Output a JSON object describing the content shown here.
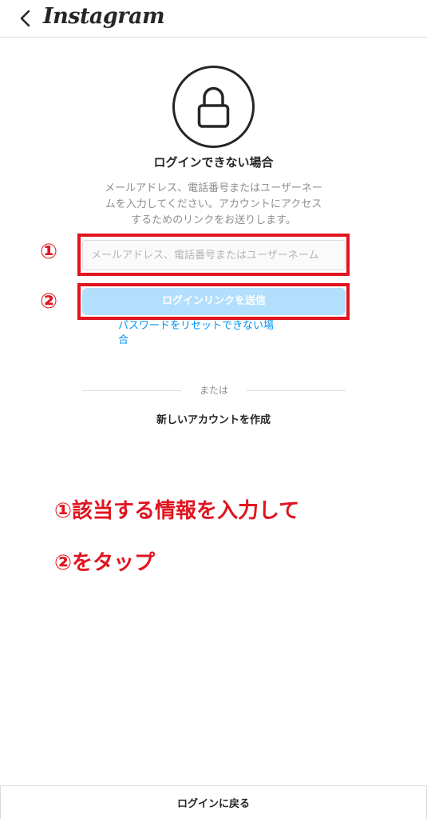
{
  "header": {
    "back_icon": "chevron-left-icon",
    "brand": "Instagram"
  },
  "lock_icon": "lock-icon",
  "title": "ログインできない場合",
  "description_lines": [
    "メールアドレス、電話番号またはユーザーネー",
    "ムを入力してください。アカウントにアクセス",
    "するためのリンクをお送りします。"
  ],
  "form": {
    "email_placeholder": "メールアドレス、電話番号またはユーザーネーム",
    "send_label": "ログインリンクを送信"
  },
  "reset_link_lines": [
    "パスワードをリセットできない場",
    "合"
  ],
  "divider_text": "または",
  "create_account": "新しいアカウントを作成",
  "annotations": {
    "num1": "①",
    "num2": "②",
    "instruction1": "①該当する情報を入力して",
    "instruction2": "②をタップ",
    "color": "#e0141f"
  },
  "footer": {
    "back_to_login": "ログインに戻る"
  },
  "colors": {
    "link": "#0095f6",
    "button_disabled": "#b2dffc",
    "text": "#262626",
    "muted": "#8e8e8e",
    "border": "#dbdbdb"
  }
}
